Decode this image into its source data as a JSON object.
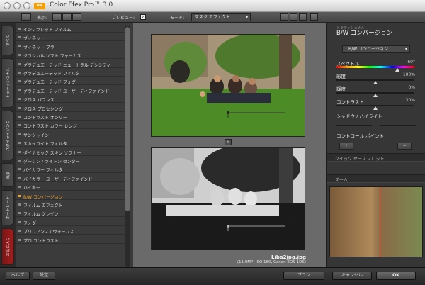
{
  "window": {
    "title": "Color Efex Pro™ 3.0",
    "badge": "nik"
  },
  "toolbar": {
    "display_label": "表示:",
    "preview_label": "プレビュー:",
    "preview_check": "✓",
    "mode_label": "モード:",
    "mode_value": "マスク エフェクト",
    "mode_arrow": "▾"
  },
  "side_tabs": [
    "すべて",
    "トラディショナル",
    "スタイライジング",
    "風景",
    "ポートレート",
    "お気に入り"
  ],
  "filters": [
    "インフラレッド フィルム",
    "ヴィネット",
    "ヴィネット ブラー",
    "クラシカル ソフト フォーカス",
    "グラデュエーテッド ニュートラル デンシティ",
    "グラデュエーテッド フィルタ",
    "グラデュエーテッド フォグ",
    "グラデュエーテッド ユーザーディファインド",
    "クロス バランス",
    "クロス プロセシング",
    "コントラスト オンリー",
    "コントラスト カラー レンジ",
    "サンシャイン",
    "スカイライト フィルタ",
    "ダイナミック スキン ソフナー",
    "ダークン / ライトン センター",
    "バイカラー フィルタ",
    "バイカラー ユーザーディファインド",
    "ハイキー",
    "B/W コンバージョン",
    "フィルム エフェクト",
    "フィルム グレイン",
    "フォグ",
    "ブリリアンス / ウォームス",
    "プロ コントラスト"
  ],
  "active_filter_index": 19,
  "preview": {
    "file_name": "Liba2jpg.jpg",
    "file_info": "(11.0MP, ISO 160, Canon EOS-1DS)",
    "split_icon": "⇕"
  },
  "panel": {
    "subtitle": "トラディショナル",
    "title": "B/W コンバージョン",
    "preset": "B/W コンバージョン",
    "params": [
      {
        "label": "スペクトル",
        "value": "60°"
      },
      {
        "label": "彩度",
        "value": "100%"
      },
      {
        "label": "輝度",
        "value": "0%"
      },
      {
        "label": "コントラスト",
        "value": "30%"
      }
    ],
    "shadow_highlight": "シャドウ / ハイライト",
    "control_point": "コントロール ポイント",
    "quick_save": "クイック セーブ スロット",
    "zoom": "ズーム"
  },
  "footer": {
    "help": "ヘルプ",
    "settings": "設定",
    "brush": "ブラシ",
    "cancel": "キャンセル",
    "ok": "OK"
  },
  "colors": {
    "accent": "#f0a020",
    "favorites": "#a11d1d"
  }
}
